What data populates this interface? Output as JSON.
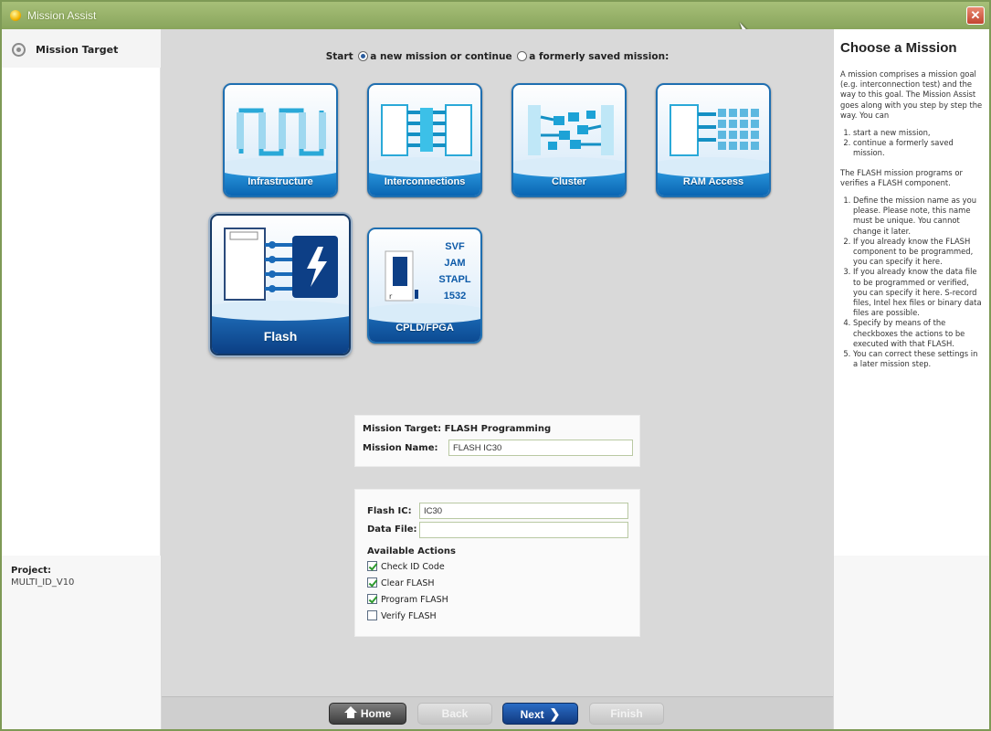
{
  "window": {
    "title": "Mission Assist"
  },
  "left_panel": {
    "title": "Mission Target",
    "project_label": "Project:",
    "project_value": "MULTI_ID_V10"
  },
  "start_row": {
    "prefix": "Start",
    "option_new": "a new mission or continue",
    "option_saved": "a formerly saved mission:"
  },
  "tiles": [
    {
      "label": "Infrastructure",
      "icon": "infrastructure-icon"
    },
    {
      "label": "Interconnections",
      "icon": "interconnections-icon"
    },
    {
      "label": "Cluster",
      "icon": "cluster-icon"
    },
    {
      "label": "RAM Access",
      "icon": "ram-access-icon"
    },
    {
      "label": "Flash",
      "icon": "flash-icon",
      "selected": true
    },
    {
      "label": "CPLD/FPGA",
      "icon": "cpld-fpga-icon",
      "formats": [
        "SVF",
        "JAM",
        "STAPL",
        "1532"
      ]
    }
  ],
  "mission": {
    "target_text": "Mission Target: FLASH Programming",
    "name_label": "Mission Name:",
    "name_value": "FLASH IC30"
  },
  "flash": {
    "flash_ic_label": "Flash IC:",
    "flash_ic_value": "IC30",
    "data_file_label": "Data File:",
    "data_file_value": "",
    "actions_title": "Available Actions",
    "actions": [
      {
        "label": "Check ID Code",
        "checked": true
      },
      {
        "label": "Clear FLASH",
        "checked": true
      },
      {
        "label": "Program FLASH",
        "checked": true
      },
      {
        "label": "Verify FLASH",
        "checked": false
      }
    ]
  },
  "help": {
    "title": "Choose a Mission",
    "intro": "A mission comprises a mission goal (e.g. interconnection test) and the way to this goal. The Mission Assist goes along with you step by step the way. You can",
    "intro_items": [
      "start a new mission,",
      "continue a formerly saved mission."
    ],
    "flash_intro": "The FLASH mission programs or verifies a FLASH component.",
    "flash_items": [
      "Define the mission name as you please. Please note, this name must be unique. You cannot change it later.",
      "If you already know the FLASH component to be programmed, you can specify it here.",
      "If you already know the data file to be programmed or verified, you can specify it here. S-record files, Intel hex files or binary data files are possible.",
      "Specify by means of the checkboxes the actions to be executed with that FLASH.",
      "You can correct these settings in a later mission step."
    ]
  },
  "buttons": {
    "home": "Home",
    "back": "Back",
    "next": "Next",
    "finish": "Finish"
  },
  "colors": {
    "tile_blue": "#0a66b3",
    "title_bar": "#89a55c",
    "next_button": "#113a80"
  }
}
